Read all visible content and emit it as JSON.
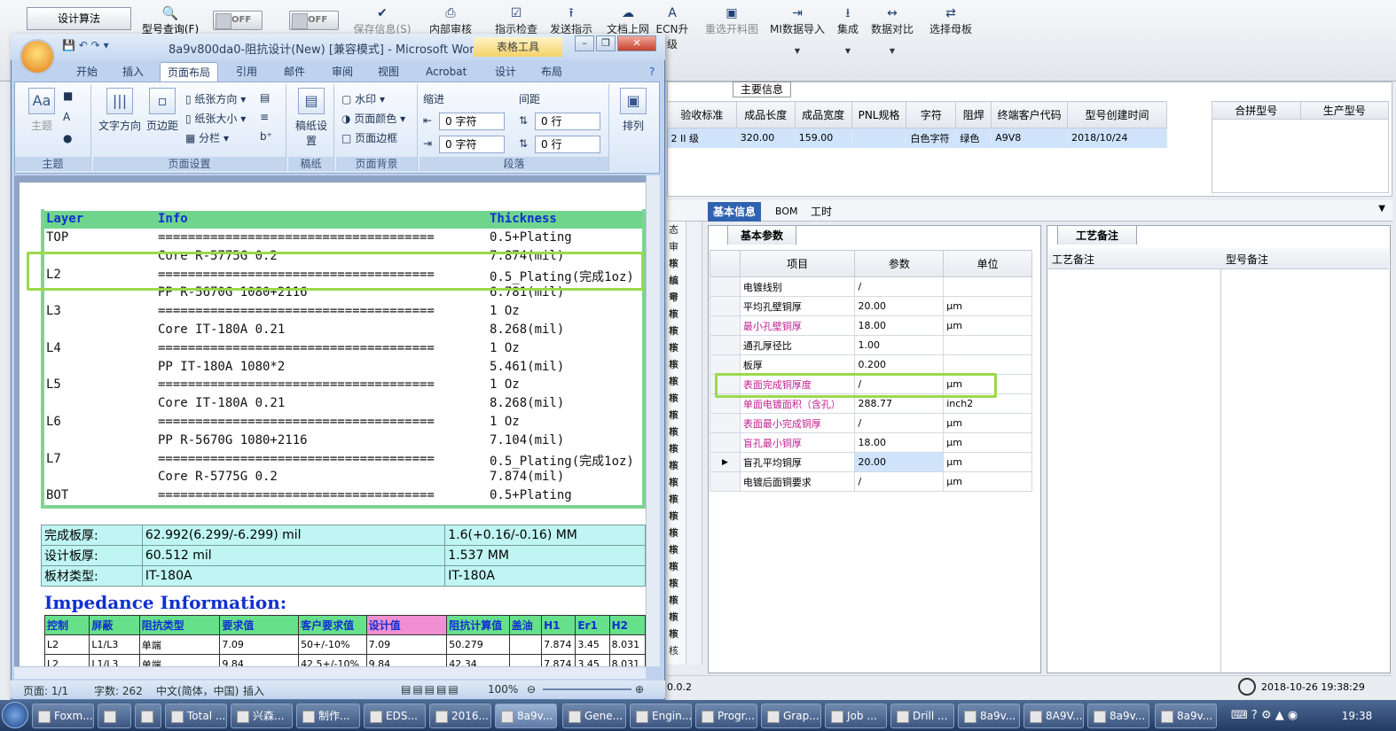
{
  "app": {
    "design_button": "设计算法",
    "search_button": "型号查询(F)",
    "toggle_1": "OFF",
    "toggle_2": "OFF",
    "toolbar": [
      {
        "label": "保存信息(S)",
        "icon": "check-icon",
        "disabled": true
      },
      {
        "label": "内部审核",
        "icon": "print-icon",
        "disabled": false
      },
      {
        "label": "指示检查",
        "icon": "checkbox-icon",
        "disabled": false
      },
      {
        "label": "发送指示",
        "icon": "upload-icon",
        "disabled": false
      },
      {
        "label": "文档上网",
        "icon": "cloud-upload-icon",
        "disabled": false
      },
      {
        "label": "ECN升级",
        "icon": "ecn-icon",
        "disabled": false
      },
      {
        "label": "重选开料图",
        "icon": "image-icon",
        "disabled": true
      },
      {
        "label": "MI数据导入",
        "icon": "import-icon",
        "disabled": false
      },
      {
        "label": "集成",
        "icon": "download-icon",
        "disabled": false
      },
      {
        "label": "数据对比",
        "icon": "compare-icon",
        "disabled": false
      },
      {
        "label": "选择母板",
        "icon": "shuffle-icon",
        "disabled": false
      }
    ],
    "main_info": {
      "title": "主要信息",
      "headers": [
        "验收标准",
        "成品长度",
        "成品宽度",
        "PNL规格",
        "字符",
        "阻焊",
        "终端客户代码",
        "型号创建时间"
      ],
      "row": [
        "2 II 级",
        "320.00",
        "159.00",
        "",
        "白色字符",
        "绿色",
        "A9V8",
        "2018/10/24"
      ],
      "merge_headers": [
        "合拼型号",
        "生产型号"
      ]
    },
    "bottom_tabs": [
      "基本信息",
      "BOM",
      "工时"
    ],
    "left_rows": [
      "态",
      "审核",
      "审核",
      "编号",
      "审核",
      "审核",
      "审核",
      "审核",
      "审核",
      "审核",
      "审核",
      "审核",
      "审核",
      "审核",
      "审核",
      "审核",
      "审核",
      "审核",
      "审核",
      "审核",
      "审核",
      "审核",
      "审核",
      "审核",
      "审核"
    ],
    "basic_params": {
      "tab": "基本参数",
      "headers": [
        "项目",
        "参数",
        "单位"
      ],
      "rows": [
        {
          "item": "电镀线别",
          "value": "/",
          "unit": "",
          "red": false
        },
        {
          "item": "平均孔壁铜厚",
          "value": "20.00",
          "unit": "μm",
          "red": false
        },
        {
          "item": "最小孔壁铜厚",
          "value": "18.00",
          "unit": "μm",
          "red": true
        },
        {
          "item": "通孔厚径比",
          "value": "1.00",
          "unit": "",
          "red": false
        },
        {
          "item": "板厚",
          "value": "0.200",
          "unit": "",
          "red": false
        },
        {
          "item": "表面完成铜厚度",
          "value": "/",
          "unit": "μm",
          "red": true
        },
        {
          "item": "单面电镀面积（含孔）",
          "value": "288.77",
          "unit": "inch2",
          "red": true
        },
        {
          "item": "表面最小完成铜厚",
          "value": "/",
          "unit": "μm",
          "red": true
        },
        {
          "item": "盲孔最小铜厚",
          "value": "18.00",
          "unit": "μm",
          "red": true
        },
        {
          "item": "盲孔平均铜厚",
          "value": "20.00",
          "unit": "μm",
          "red": false
        },
        {
          "item": "电镀后面铜要求",
          "value": "/",
          "unit": "μm",
          "red": false
        }
      ]
    },
    "process_notes": {
      "tab": "工艺备注",
      "col1": "工艺备注",
      "col2": "型号备注"
    },
    "status_version": "0.0.2",
    "status_time": "2018-10-26 19:38:29"
  },
  "word": {
    "title": "8a9v800da0-阻抗设计(New) [兼容模式] - Microsoft Word",
    "table_tools": "表格工具",
    "tabs": [
      "开始",
      "插入",
      "页面布局",
      "引用",
      "邮件",
      "审阅",
      "视图",
      "Acrobat",
      "设计",
      "布局"
    ],
    "ribbon": {
      "theme_group": "主题",
      "theme_btn": "主题",
      "text_dir": "文字方向",
      "margins": "页边距",
      "orientation": "纸张方向",
      "size": "纸张大小",
      "columns": "分栏",
      "page_setup_group": "页面设置",
      "draft": "稿纸设置",
      "draft_group": "稿纸",
      "watermark": "水印",
      "page_color": "页面颜色",
      "page_border": "页面边框",
      "bg_group": "页面背景",
      "indent": "缩进",
      "spacing": "间距",
      "indent_left": "0 字符",
      "indent_right": "0 字符",
      "spacing_before": "0 行",
      "spacing_after": "0 行",
      "para_group": "段落",
      "arrange": "排列"
    },
    "stack": {
      "headers": [
        "Layer",
        "Info",
        "Thickness"
      ],
      "rows": [
        [
          "TOP",
          "=====================================",
          "0.5+Plating"
        ],
        [
          "",
          "Core     R-5775G    0.2",
          "7.874(mil)"
        ],
        [
          "L2",
          "=====================================",
          "0.5_Plating(完成1oz)"
        ],
        [
          "",
          "PP     R-5670G    1080+2116",
          "6.781(mil)"
        ],
        [
          "L3",
          "=====================================",
          "1 Oz"
        ],
        [
          "",
          "Core     IT-180A    0.21",
          "8.268(mil)"
        ],
        [
          "L4",
          "=====================================",
          "1 Oz"
        ],
        [
          "",
          "PP     IT-180A    1080*2",
          "5.461(mil)"
        ],
        [
          "L5",
          "=====================================",
          "1 Oz"
        ],
        [
          "",
          "Core     IT-180A    0.21",
          "8.268(mil)"
        ],
        [
          "L6",
          "=====================================",
          "1 Oz"
        ],
        [
          "",
          "PP     R-5670G    1080+2116",
          "7.104(mil)"
        ],
        [
          "L7",
          "=====================================",
          "0.5_Plating(完成1oz)"
        ],
        [
          "",
          "Core     R-5775G    0.2",
          "7.874(mil)"
        ],
        [
          "BOT",
          "=====================================",
          "0.5+Plating"
        ]
      ]
    },
    "summary": [
      [
        "完成板厚:",
        "62.992(6.299/-6.299) mil",
        "1.6(+0.16/-0.16) MM"
      ],
      [
        "设计板厚:",
        "60.512 mil",
        "1.537 MM"
      ],
      [
        "板材类型:",
        "IT-180A",
        "IT-180A"
      ]
    ],
    "impedance_title": "Impedance Information:",
    "impedance_headers": [
      "控制",
      "屏蔽",
      "阻抗类型",
      "要求值",
      "客户要求值",
      "设计值",
      "阻抗计算值",
      "盖油",
      "H1",
      "Er1",
      "H2"
    ],
    "impedance_rows": [
      [
        "L2",
        "L1/L3",
        "单端",
        "7.09",
        "50+/-10%",
        "7.09",
        "50.279",
        "",
        "7.874",
        "3.45",
        "8.031"
      ],
      [
        "L2",
        "L1/L3",
        "单端",
        "9.84",
        "42.5+/-10%",
        "9.84",
        "42.34",
        "",
        "7.874",
        "3.45",
        "8.031"
      ]
    ],
    "status": {
      "page": "页面: 1/1",
      "words": "字数: 262",
      "lang": "中文(简体，中国)",
      "mode": "插入",
      "zoom": "100%"
    }
  },
  "taskbar": {
    "items": [
      "Foxm...",
      "",
      "",
      "Total ...",
      "兴森...",
      "制作...",
      "EDS...",
      "2016...",
      "8a9v...",
      "Gene...",
      "Engin...",
      "Progr...",
      "Grap...",
      "Job ...",
      "Drill ...",
      "8a9v...",
      "8A9V...",
      "8a9v...",
      "8a9v..."
    ],
    "clock": "19:38"
  }
}
